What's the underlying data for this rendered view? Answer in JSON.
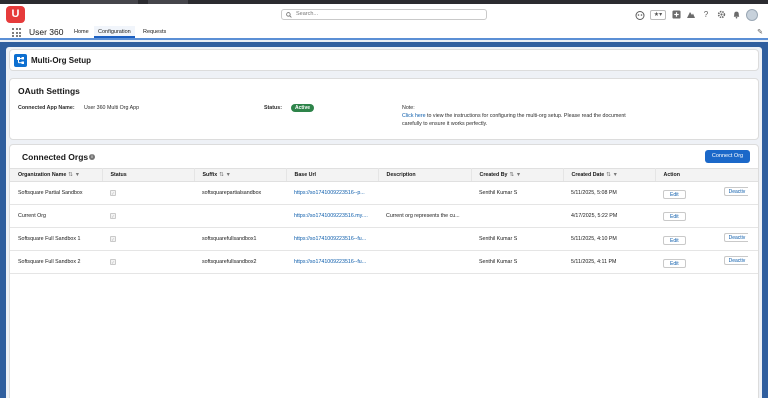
{
  "header": {
    "logo_text": "U",
    "search_placeholder": "Search...",
    "favorites_glyph": "★▾",
    "icons": [
      "setup-helper-icon",
      "favorites-icon",
      "add-icon",
      "trailhead-icon",
      "help-icon",
      "settings-icon",
      "notifications-icon",
      "avatar"
    ]
  },
  "nav": {
    "app_name": "User 360",
    "tabs": [
      {
        "label": "Home",
        "active": false
      },
      {
        "label": "Configuration",
        "active": true
      },
      {
        "label": "Requests",
        "active": false
      }
    ]
  },
  "page": {
    "title": "Multi-Org Setup"
  },
  "oauth": {
    "title": "OAuth Settings",
    "app_name_label": "Connected App Name:",
    "app_name_value": "User 360 Multi Org App",
    "status_label": "Status:",
    "status_value": "Active",
    "note_label": "Note:",
    "note_link": "Click here",
    "note_text": " to view the instructions for configuring the multi-org setup. Please read the document carefully to ensure it works perfectly."
  },
  "orgs": {
    "title": "Connected Orgs",
    "connect_button": "Connect Org",
    "columns": [
      "Organization Name",
      "Status",
      "Suffix",
      "Base Url",
      "Description",
      "Created By",
      "Created Date",
      "Action"
    ],
    "rows": [
      {
        "name": "Softsquare Partial Sandbox",
        "status_glyph": "✓",
        "suffix": "softsquarepartialsandbox",
        "base_url": "https://so1741009223516--p...",
        "description": "",
        "created_by": "Senthil Kumar S",
        "created_date": "5/11/2025, 5:08 PM",
        "edit": "Edit",
        "deactivate": "Deactiv"
      },
      {
        "name": "Current Org",
        "status_glyph": "✓",
        "suffix": "",
        "base_url": "https://so1741009223516.my....",
        "description": "Current org represents the cu...",
        "created_by": "",
        "created_date": "4/17/2025, 5:22 PM",
        "edit": "Edit",
        "deactivate": ""
      },
      {
        "name": "Softsquare Full Sandbox 1",
        "status_glyph": "✓",
        "suffix": "softsquarefullsandbox1",
        "base_url": "https://so1741009223516--fu...",
        "description": "",
        "created_by": "Senthil Kumar S",
        "created_date": "5/11/2025, 4:10 PM",
        "edit": "Edit",
        "deactivate": "Deactiv"
      },
      {
        "name": "Softsquare Full Sandbox 2",
        "status_glyph": "✓",
        "suffix": "softsquarefullsandbox2",
        "base_url": "https://so1741009223516--fu...",
        "description": "",
        "created_by": "Senthil Kumar S",
        "created_date": "5/11/2025, 4:11 PM",
        "edit": "Edit",
        "deactivate": "Deactiv"
      }
    ]
  },
  "colors": {
    "brand_band": "#2f5e9e",
    "primary_button": "#1b68c9",
    "active_badge": "#2e844a",
    "logo": "#e63b3b"
  }
}
